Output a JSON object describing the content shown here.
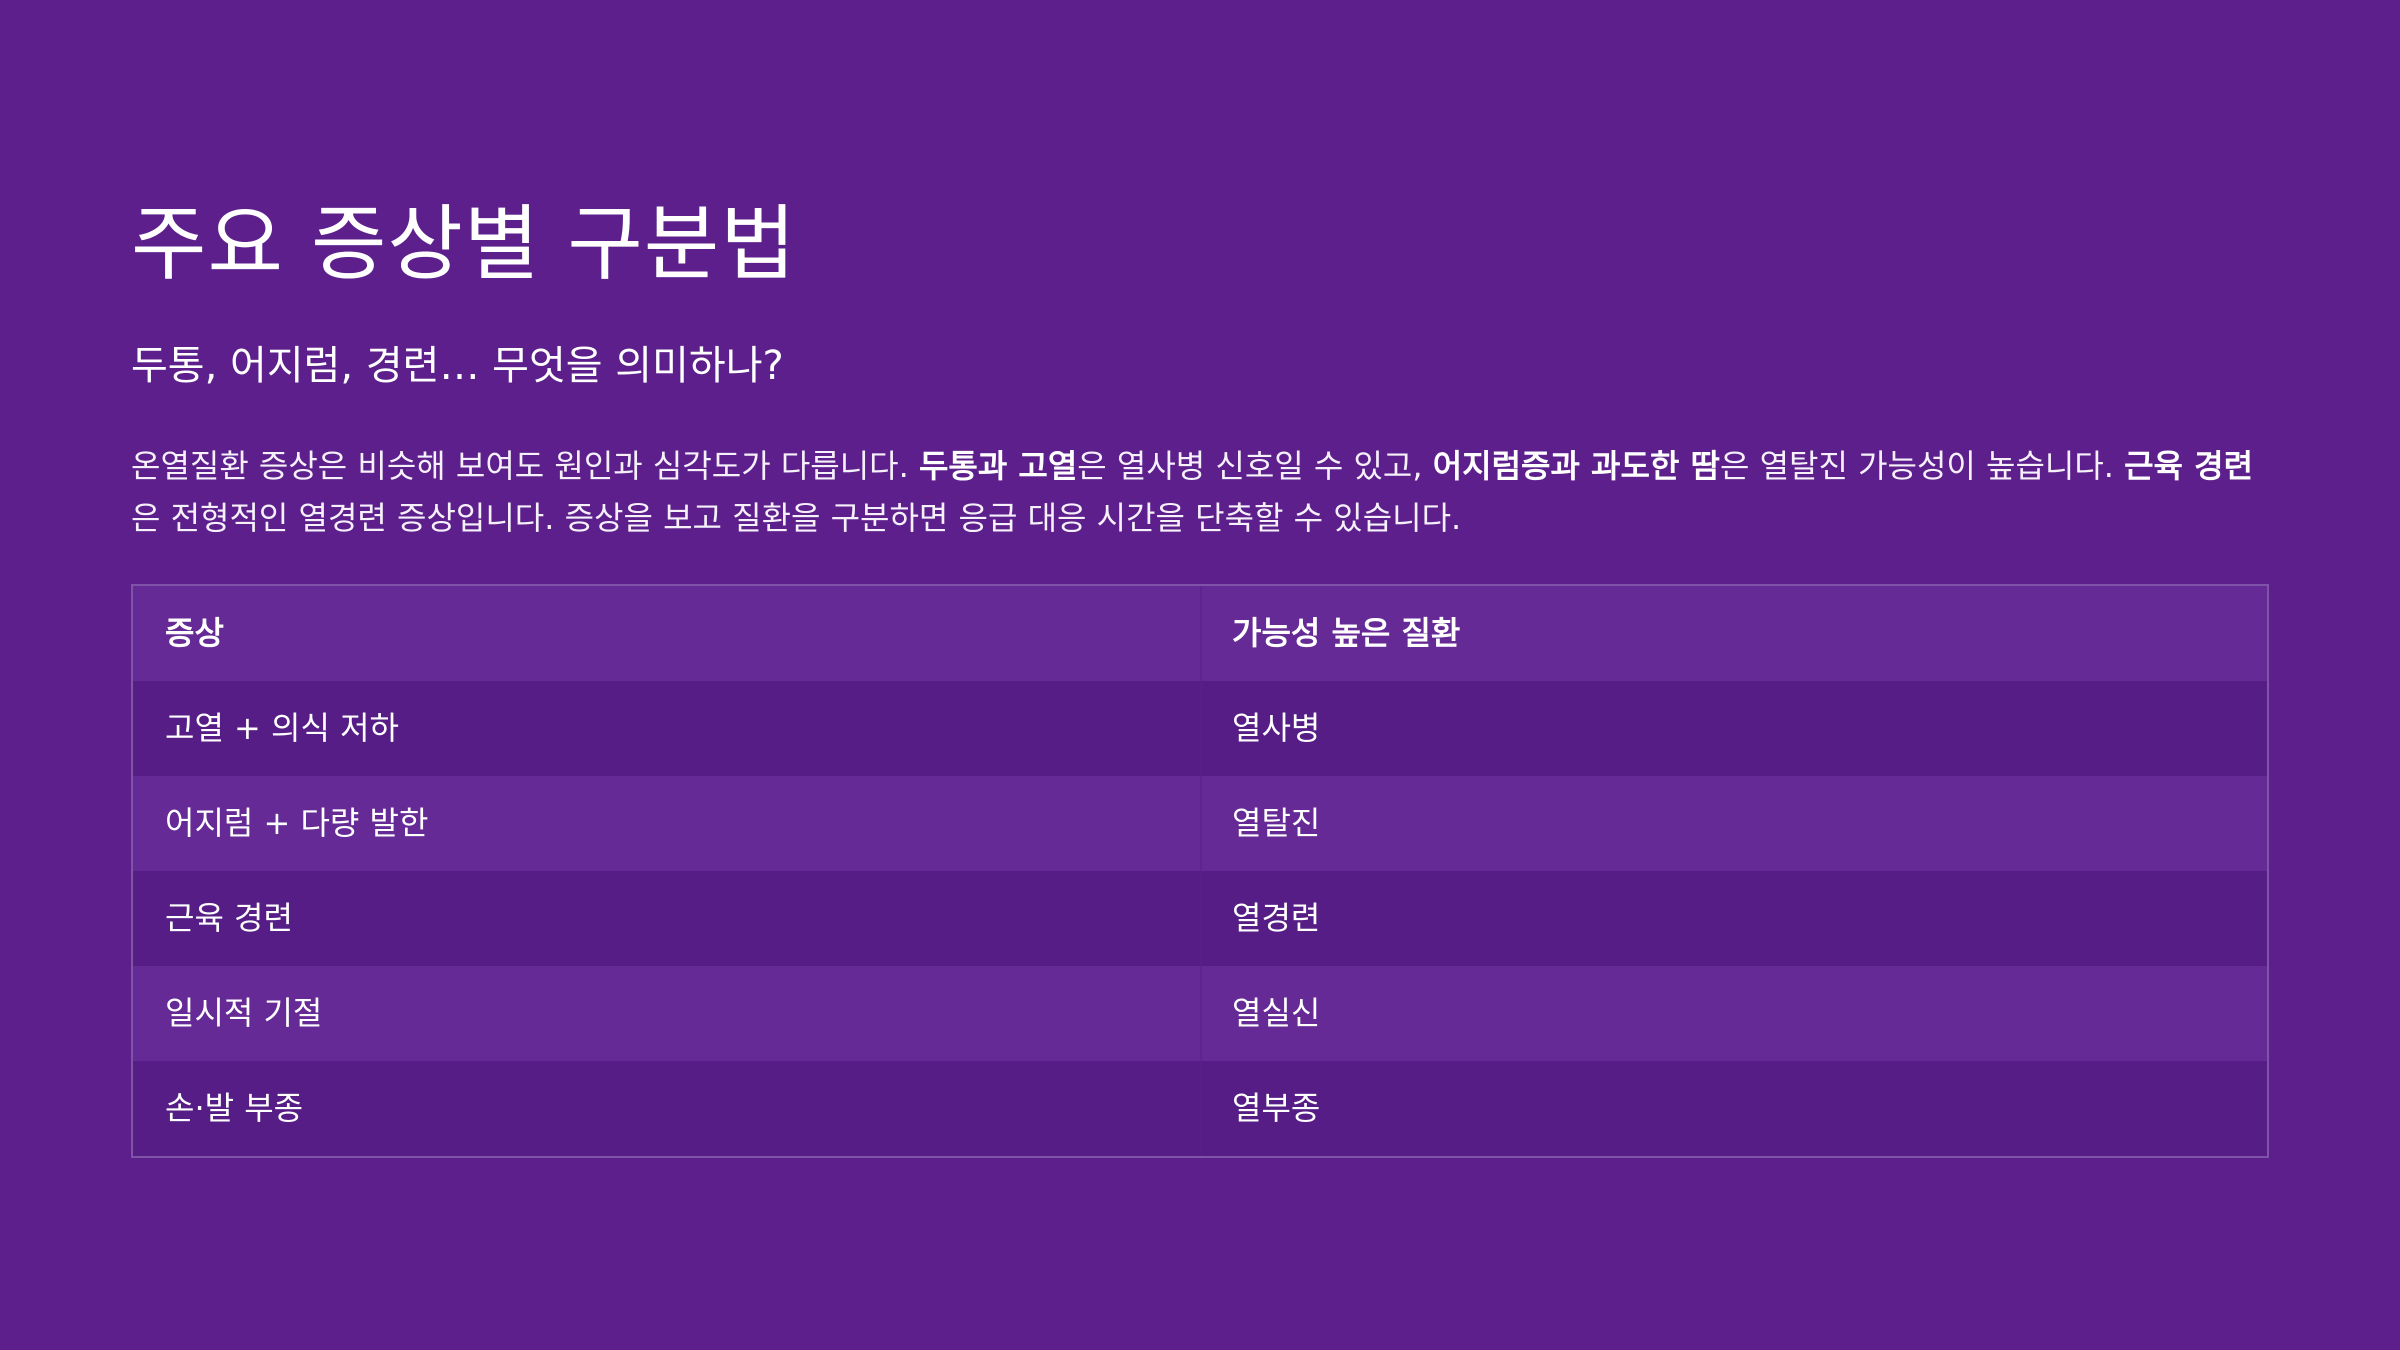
{
  "title": "주요 증상별 구분법",
  "subtitle": "두통, 어지럼, 경련… 무엇을 의미하나?",
  "paragraph": {
    "p1": "온열질환 증상은 비슷해 보여도 원인과 심각도가 다릅니다. ",
    "b1": "두통과 고열",
    "p2": "은 열사병 신호일 수 있고, ",
    "b2": "어지럼증과 과도한 땀",
    "p3": "은 열탈진 가능성이 높습니다. ",
    "b3": "근육 경련",
    "p4": "은 전형적인 열경련 증상입니다. 증상을 보고 질환을 구분하면 응급 대응 시간을 단축할 수 있습니다."
  },
  "table": {
    "headers": [
      "증상",
      "가능성 높은 질환"
    ],
    "rows": [
      [
        "고열 + 의식 저하",
        "열사병"
      ],
      [
        "어지럼 + 다량 발한",
        "열탈진"
      ],
      [
        "근육 경련",
        "열경련"
      ],
      [
        "일시적 기절",
        "열실신"
      ],
      [
        "손·발 부종",
        "열부종"
      ]
    ]
  },
  "colors": {
    "background": "#5c1f8b",
    "row_alt": "#652a95",
    "row_base": "#571d86",
    "border": "#7f53a8"
  }
}
